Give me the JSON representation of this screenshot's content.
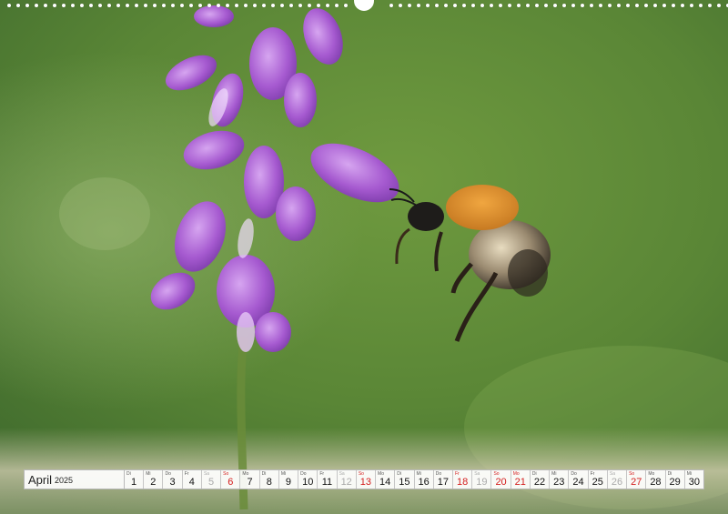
{
  "calendar": {
    "month": "April",
    "year": "2025",
    "days": [
      {
        "dow": "Di",
        "num": "1",
        "kind": "weekday"
      },
      {
        "dow": "Mi",
        "num": "2",
        "kind": "weekday"
      },
      {
        "dow": "Do",
        "num": "3",
        "kind": "weekday"
      },
      {
        "dow": "Fr",
        "num": "4",
        "kind": "weekday"
      },
      {
        "dow": "Sa",
        "num": "5",
        "kind": "sat"
      },
      {
        "dow": "So",
        "num": "6",
        "kind": "sun"
      },
      {
        "dow": "Mo",
        "num": "7",
        "kind": "weekday"
      },
      {
        "dow": "Di",
        "num": "8",
        "kind": "weekday"
      },
      {
        "dow": "Mi",
        "num": "9",
        "kind": "weekday"
      },
      {
        "dow": "Do",
        "num": "10",
        "kind": "weekday"
      },
      {
        "dow": "Fr",
        "num": "11",
        "kind": "weekday"
      },
      {
        "dow": "Sa",
        "num": "12",
        "kind": "sat"
      },
      {
        "dow": "So",
        "num": "13",
        "kind": "sun"
      },
      {
        "dow": "Mo",
        "num": "14",
        "kind": "weekday"
      },
      {
        "dow": "Di",
        "num": "15",
        "kind": "weekday"
      },
      {
        "dow": "Mi",
        "num": "16",
        "kind": "weekday"
      },
      {
        "dow": "Do",
        "num": "17",
        "kind": "weekday"
      },
      {
        "dow": "Fr",
        "num": "18",
        "kind": "hol"
      },
      {
        "dow": "Sa",
        "num": "19",
        "kind": "sat"
      },
      {
        "dow": "So",
        "num": "20",
        "kind": "sun"
      },
      {
        "dow": "Mo",
        "num": "21",
        "kind": "hol"
      },
      {
        "dow": "Di",
        "num": "22",
        "kind": "weekday"
      },
      {
        "dow": "Mi",
        "num": "23",
        "kind": "weekday"
      },
      {
        "dow": "Do",
        "num": "24",
        "kind": "weekday"
      },
      {
        "dow": "Fr",
        "num": "25",
        "kind": "weekday"
      },
      {
        "dow": "Sa",
        "num": "26",
        "kind": "sat"
      },
      {
        "dow": "So",
        "num": "27",
        "kind": "sun"
      },
      {
        "dow": "Mo",
        "num": "28",
        "kind": "weekday"
      },
      {
        "dow": "Di",
        "num": "29",
        "kind": "weekday"
      },
      {
        "dow": "Mi",
        "num": "30",
        "kind": "weekday"
      }
    ]
  },
  "colors": {
    "background_green": "#5f8a3c",
    "flower_purple": "#a65ad0",
    "bee_orange": "#d98a2a",
    "holiday_red": "#d41d1d",
    "saturday_grey": "#aaaaaa"
  },
  "photo": {
    "subject_icons": [
      "vetch-flower-icon",
      "bumblebee-icon"
    ]
  }
}
